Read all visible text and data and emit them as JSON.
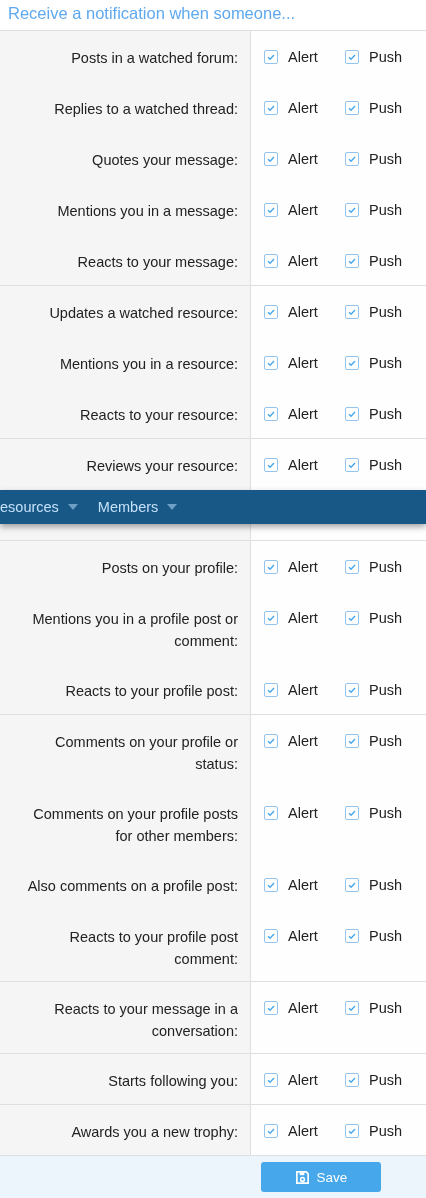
{
  "heading": "Receive a notification when someone...",
  "groups": [
    {
      "rows": [
        {
          "label": "Posts in a watched forum:",
          "options": [
            {
              "label": "Alert",
              "checked": true
            },
            {
              "label": "Push",
              "checked": true
            }
          ]
        },
        {
          "label": "Replies to a watched thread:",
          "options": [
            {
              "label": "Alert",
              "checked": true
            },
            {
              "label": "Push",
              "checked": true
            }
          ]
        },
        {
          "label": "Quotes your message:",
          "options": [
            {
              "label": "Alert",
              "checked": true
            },
            {
              "label": "Push",
              "checked": true
            }
          ]
        },
        {
          "label": "Mentions you in a message:",
          "options": [
            {
              "label": "Alert",
              "checked": true
            },
            {
              "label": "Push",
              "checked": true
            }
          ]
        },
        {
          "label": "Reacts to your message:",
          "options": [
            {
              "label": "Alert",
              "checked": true
            },
            {
              "label": "Push",
              "checked": true
            }
          ]
        }
      ]
    },
    {
      "rows": [
        {
          "label": "Updates a watched resource:",
          "options": [
            {
              "label": "Alert",
              "checked": true
            },
            {
              "label": "Push",
              "checked": true
            }
          ]
        },
        {
          "label": "Mentions you in a resource:",
          "options": [
            {
              "label": "Alert",
              "checked": true
            },
            {
              "label": "Push",
              "checked": true
            }
          ]
        },
        {
          "label": "Reacts to your resource:",
          "options": [
            {
              "label": "Alert",
              "checked": true
            },
            {
              "label": "Push",
              "checked": true
            }
          ]
        }
      ]
    },
    {
      "rows": [
        {
          "label": "Reviews your resource:",
          "options": [
            {
              "label": "Alert",
              "checked": true
            },
            {
              "label": "Push",
              "checked": true
            }
          ]
        }
      ],
      "nav_bar": {
        "items": [
          {
            "label": "esources"
          },
          {
            "label": "Members"
          }
        ]
      }
    },
    {
      "rows": [
        {
          "label": "Posts on your profile:",
          "options": [
            {
              "label": "Alert",
              "checked": true
            },
            {
              "label": "Push",
              "checked": true
            }
          ]
        },
        {
          "label": "Mentions you in a profile post or comment:",
          "options": [
            {
              "label": "Alert",
              "checked": true
            },
            {
              "label": "Push",
              "checked": true
            }
          ]
        },
        {
          "label": "Reacts to your profile post:",
          "options": [
            {
              "label": "Alert",
              "checked": true
            },
            {
              "label": "Push",
              "checked": true
            }
          ]
        }
      ]
    },
    {
      "rows": [
        {
          "label": "Comments on your profile or status:",
          "options": [
            {
              "label": "Alert",
              "checked": true
            },
            {
              "label": "Push",
              "checked": true
            }
          ]
        },
        {
          "label": "Comments on your profile posts for other members:",
          "options": [
            {
              "label": "Alert",
              "checked": true
            },
            {
              "label": "Push",
              "checked": true
            }
          ]
        },
        {
          "label": "Also comments on a profile post:",
          "options": [
            {
              "label": "Alert",
              "checked": true
            },
            {
              "label": "Push",
              "checked": true
            }
          ]
        },
        {
          "label": "Reacts to your profile post comment:",
          "options": [
            {
              "label": "Alert",
              "checked": true
            },
            {
              "label": "Push",
              "checked": true
            }
          ]
        }
      ]
    },
    {
      "rows": [
        {
          "label": "Reacts to your message in a conversation:",
          "options": [
            {
              "label": "Alert",
              "checked": true
            },
            {
              "label": "Push",
              "checked": true
            }
          ]
        }
      ]
    },
    {
      "rows": [
        {
          "label": "Starts following you:",
          "options": [
            {
              "label": "Alert",
              "checked": true
            },
            {
              "label": "Push",
              "checked": true
            }
          ]
        }
      ]
    },
    {
      "rows": [
        {
          "label": "Awards you a new trophy:",
          "options": [
            {
              "label": "Alert",
              "checked": true
            },
            {
              "label": "Push",
              "checked": true
            }
          ]
        }
      ]
    }
  ],
  "save_button": {
    "label": "Save"
  }
}
